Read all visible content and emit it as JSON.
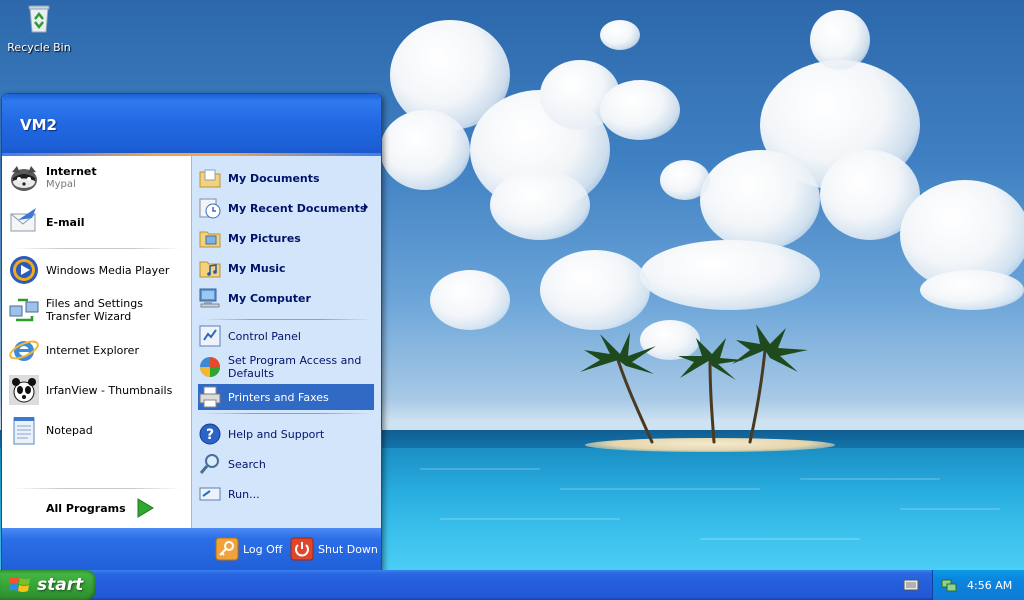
{
  "desktop": {
    "recycle_bin_label": "Recycle Bin"
  },
  "start_menu": {
    "user_name": "VM2",
    "pinned": [
      {
        "title": "Internet",
        "subtitle": "Mypal",
        "icon": "mypal-browser-icon"
      },
      {
        "title": "E-mail",
        "icon": "email-icon"
      }
    ],
    "recent_programs": [
      {
        "label": "Windows Media Player",
        "icon": "media-player-icon"
      },
      {
        "label": "Files and Settings Transfer Wizard",
        "icon": "transfer-wizard-icon"
      },
      {
        "label": "Internet Explorer",
        "icon": "internet-explorer-icon"
      },
      {
        "label": "IrfanView - Thumbnails",
        "icon": "irfanview-icon"
      },
      {
        "label": "Notepad",
        "icon": "notepad-icon"
      }
    ],
    "all_programs_label": "All Programs",
    "places": [
      {
        "label": "My Documents",
        "icon": "documents-folder-icon"
      },
      {
        "label": "My Recent Documents",
        "icon": "recent-documents-icon",
        "has_submenu": true
      },
      {
        "label": "My Pictures",
        "icon": "pictures-folder-icon"
      },
      {
        "label": "My Music",
        "icon": "music-folder-icon"
      },
      {
        "label": "My Computer",
        "icon": "computer-icon"
      }
    ],
    "system": [
      {
        "label": "Control Panel",
        "icon": "control-panel-icon"
      },
      {
        "label": "Set Program Access and Defaults",
        "icon": "program-defaults-icon"
      },
      {
        "label": "Printers and Faxes",
        "icon": "printer-icon",
        "highlighted": true
      }
    ],
    "help": [
      {
        "label": "Help and Support",
        "icon": "help-icon"
      },
      {
        "label": "Search",
        "icon": "search-icon"
      },
      {
        "label": "Run...",
        "icon": "run-icon"
      }
    ],
    "log_off_label": "Log Off",
    "shut_down_label": "Shut Down"
  },
  "taskbar": {
    "start_label": "start",
    "clock": "4:56 AM"
  },
  "colors": {
    "taskbar_blue": "#245ddb",
    "start_green": "#3aa53a",
    "menu_header_blue": "#2269e2",
    "right_pane": "#d3e5fa",
    "highlight": "#316ac5"
  }
}
